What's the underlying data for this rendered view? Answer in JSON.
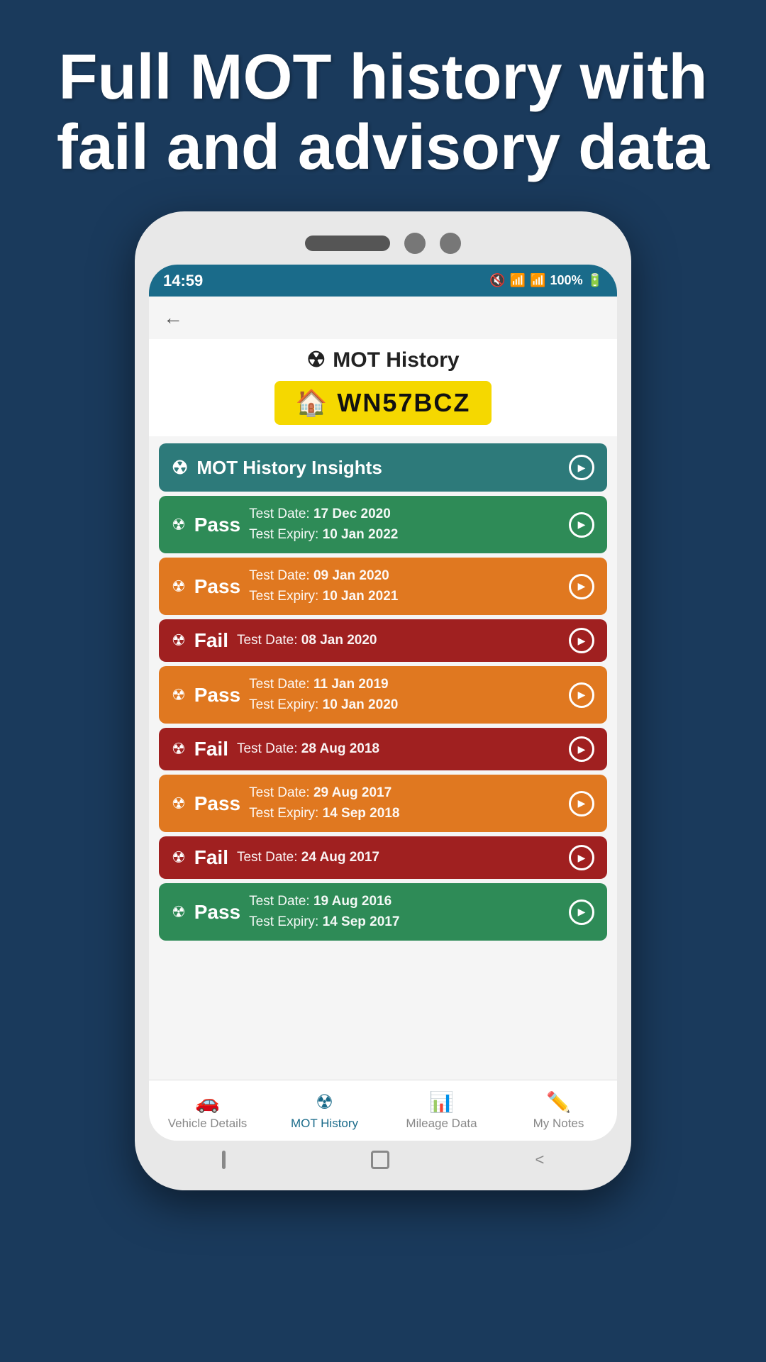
{
  "page": {
    "header_line1": "Full MOT history with",
    "header_line2": "fail and advisory data"
  },
  "status_bar": {
    "time": "14:59",
    "battery": "100%",
    "icons": "🔇 📶 📶 🔋"
  },
  "app": {
    "screen_title": "MOT History",
    "reg_plate": "WN57BCZ",
    "insights_label": "MOT History Insights",
    "records": [
      {
        "result": "Pass",
        "type": "pass-green",
        "test_date_label": "Test Date:",
        "test_date_value": "17 Dec 2020",
        "expiry_label": "Test Expiry:",
        "expiry_value": "10 Jan 2022"
      },
      {
        "result": "Pass",
        "type": "pass-orange",
        "test_date_label": "Test Date:",
        "test_date_value": "09 Jan 2020",
        "expiry_label": "Test Expiry:",
        "expiry_value": "10 Jan 2021"
      },
      {
        "result": "Fail",
        "type": "fail-red",
        "test_date_label": "Test Date:",
        "test_date_value": "08 Jan 2020",
        "expiry_label": null,
        "expiry_value": null
      },
      {
        "result": "Pass",
        "type": "pass-orange",
        "test_date_label": "Test Date:",
        "test_date_value": "11 Jan 2019",
        "expiry_label": "Test Expiry:",
        "expiry_value": "10 Jan 2020"
      },
      {
        "result": "Fail",
        "type": "fail-red",
        "test_date_label": "Test Date:",
        "test_date_value": "28 Aug 2018",
        "expiry_label": null,
        "expiry_value": null
      },
      {
        "result": "Pass",
        "type": "pass-orange",
        "test_date_label": "Test Date:",
        "test_date_value": "29 Aug 2017",
        "expiry_label": "Test Expiry:",
        "expiry_value": "14 Sep 2018"
      },
      {
        "result": "Fail",
        "type": "fail-red",
        "test_date_label": "Test Date:",
        "test_date_value": "24 Aug 2017",
        "expiry_label": null,
        "expiry_value": null
      },
      {
        "result": "Pass",
        "type": "pass-green",
        "test_date_label": "Test Date:",
        "test_date_value": "19 Aug 2016",
        "expiry_label": "Test Expiry:",
        "expiry_value": "14 Sep 2017"
      }
    ],
    "nav_items": [
      {
        "label": "Vehicle Details",
        "icon": "🚗",
        "active": false
      },
      {
        "label": "MOT History",
        "icon": "☢",
        "active": true
      },
      {
        "label": "Mileage Data",
        "icon": "📊",
        "active": false
      },
      {
        "label": "My Notes",
        "icon": "✏️",
        "active": false
      }
    ]
  }
}
